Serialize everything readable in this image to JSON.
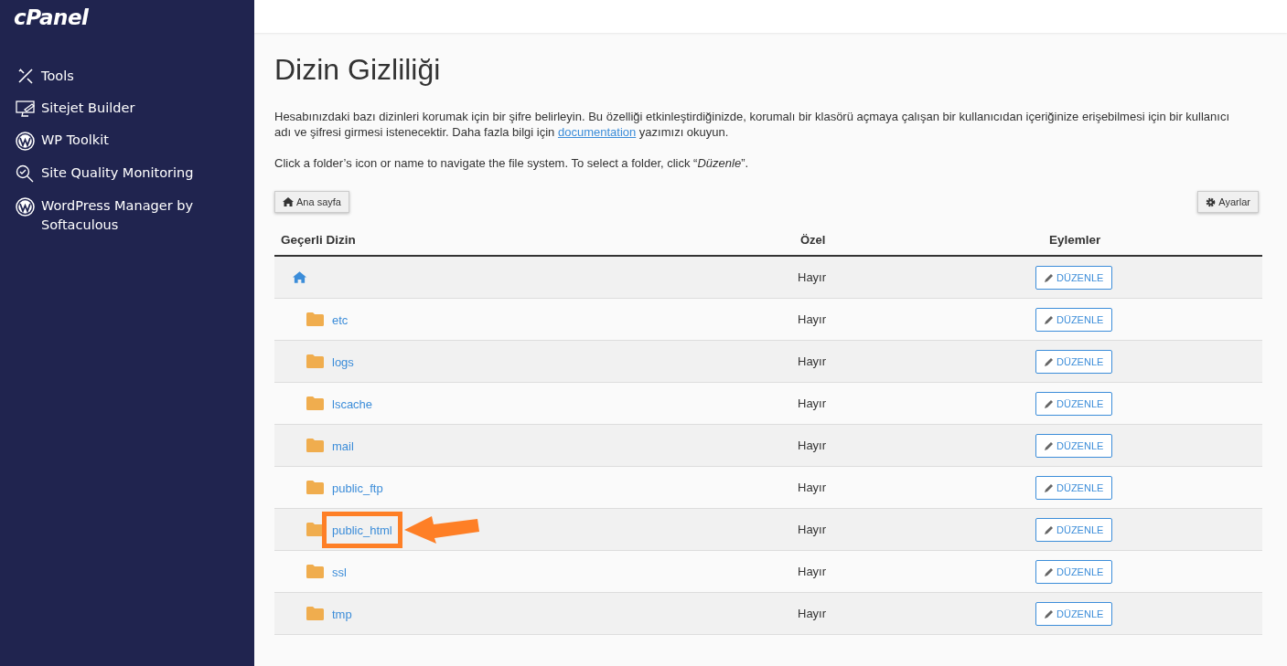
{
  "sidebar": {
    "logo": "cPanel",
    "items": [
      {
        "label": "Tools",
        "kind": "tools"
      },
      {
        "label": "Sitejet Builder",
        "kind": "monitor"
      },
      {
        "label": "WP Toolkit",
        "kind": "wordpress"
      },
      {
        "label": "Site Quality Monitoring",
        "kind": "magnifier"
      },
      {
        "label": "WordPress Manager by Softaculous",
        "kind": "wordpress"
      }
    ]
  },
  "page": {
    "title": "Dizin Gizliliği",
    "description": {
      "before": "Hesabınızdaki bazı dizinleri korumak için bir şifre belirleyin. Bu özelliği etkinleştirdiğinizde, korumalı bir klasörü açmaya çalışan bir kullanıcıdan içeriğinize erişebilmesi için bir kullanıcı adı ve şifresi girmesi istenecektir. Daha fazla bilgi için",
      "link": "documentation",
      "after": "yazımızı okuyun."
    },
    "hint": "Click a folder’s icon or name to navigate the file system. To select a folder, click “*Düzenle*”.",
    "home_button": "Ana sayfa",
    "settings_button": "Ayarlar"
  },
  "table": {
    "columns": [
      "Geçerli Dizin",
      "Özel",
      "Eylemler"
    ],
    "rows": [
      {
        "kind": "home",
        "private": "Hayır",
        "action": "DÜZENLE"
      },
      {
        "kind": "folder",
        "name": "etc",
        "private": "Hayır",
        "action": "DÜZENLE"
      },
      {
        "kind": "folder",
        "name": "logs",
        "private": "Hayır",
        "action": "DÜZENLE"
      },
      {
        "kind": "folder",
        "name": "lscache",
        "private": "Hayır",
        "action": "DÜZENLE"
      },
      {
        "kind": "folder",
        "name": "mail",
        "private": "Hayır",
        "action": "DÜZENLE"
      },
      {
        "kind": "folder",
        "name": "public_ftp",
        "private": "Hayır",
        "action": "DÜZENLE"
      },
      {
        "kind": "folder",
        "name": "public_html",
        "private": "Hayır",
        "action": "DÜZENLE",
        "highlighted": true
      },
      {
        "kind": "folder",
        "name": "ssl",
        "private": "Hayır",
        "action": "DÜZENLE"
      },
      {
        "kind": "folder",
        "name": "tmp",
        "private": "Hayır",
        "action": "DÜZENLE"
      }
    ]
  }
}
